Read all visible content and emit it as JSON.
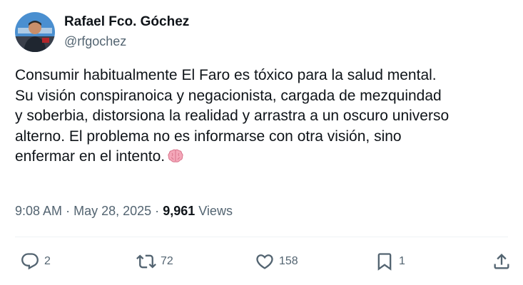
{
  "author": {
    "name": "Rafael Fco. Góchez",
    "handle": "@rfgochez",
    "avatar": "avatar-photo"
  },
  "tweet": {
    "lines": [
      "Consumir habitualmente El Faro es tóxico para la salud mental.",
      "Su visión conspiranoica y negacionista, cargada de mezquindad",
      "y soberbia, distorsiona la realidad y arrastra a un oscuro universo",
      "alterno. El problema no es informarse con otra visión, sino",
      "enfermar en el intento."
    ],
    "emoji": "brain-emoji"
  },
  "meta": {
    "time": "9:08 AM",
    "separator": "·",
    "date": "May 28, 2025",
    "views_count": "9,961",
    "views_label": "Views"
  },
  "actions": {
    "reply": {
      "icon": "reply-icon",
      "count": "2"
    },
    "retweet": {
      "icon": "retweet-icon",
      "count": "72"
    },
    "like": {
      "icon": "heart-icon",
      "count": "158"
    },
    "bookmark": {
      "icon": "bookmark-icon",
      "count": "1"
    },
    "share": {
      "icon": "share-icon"
    }
  },
  "colors": {
    "text_primary": "#0f1419",
    "text_secondary": "#536471",
    "divider": "#eff3f4"
  }
}
